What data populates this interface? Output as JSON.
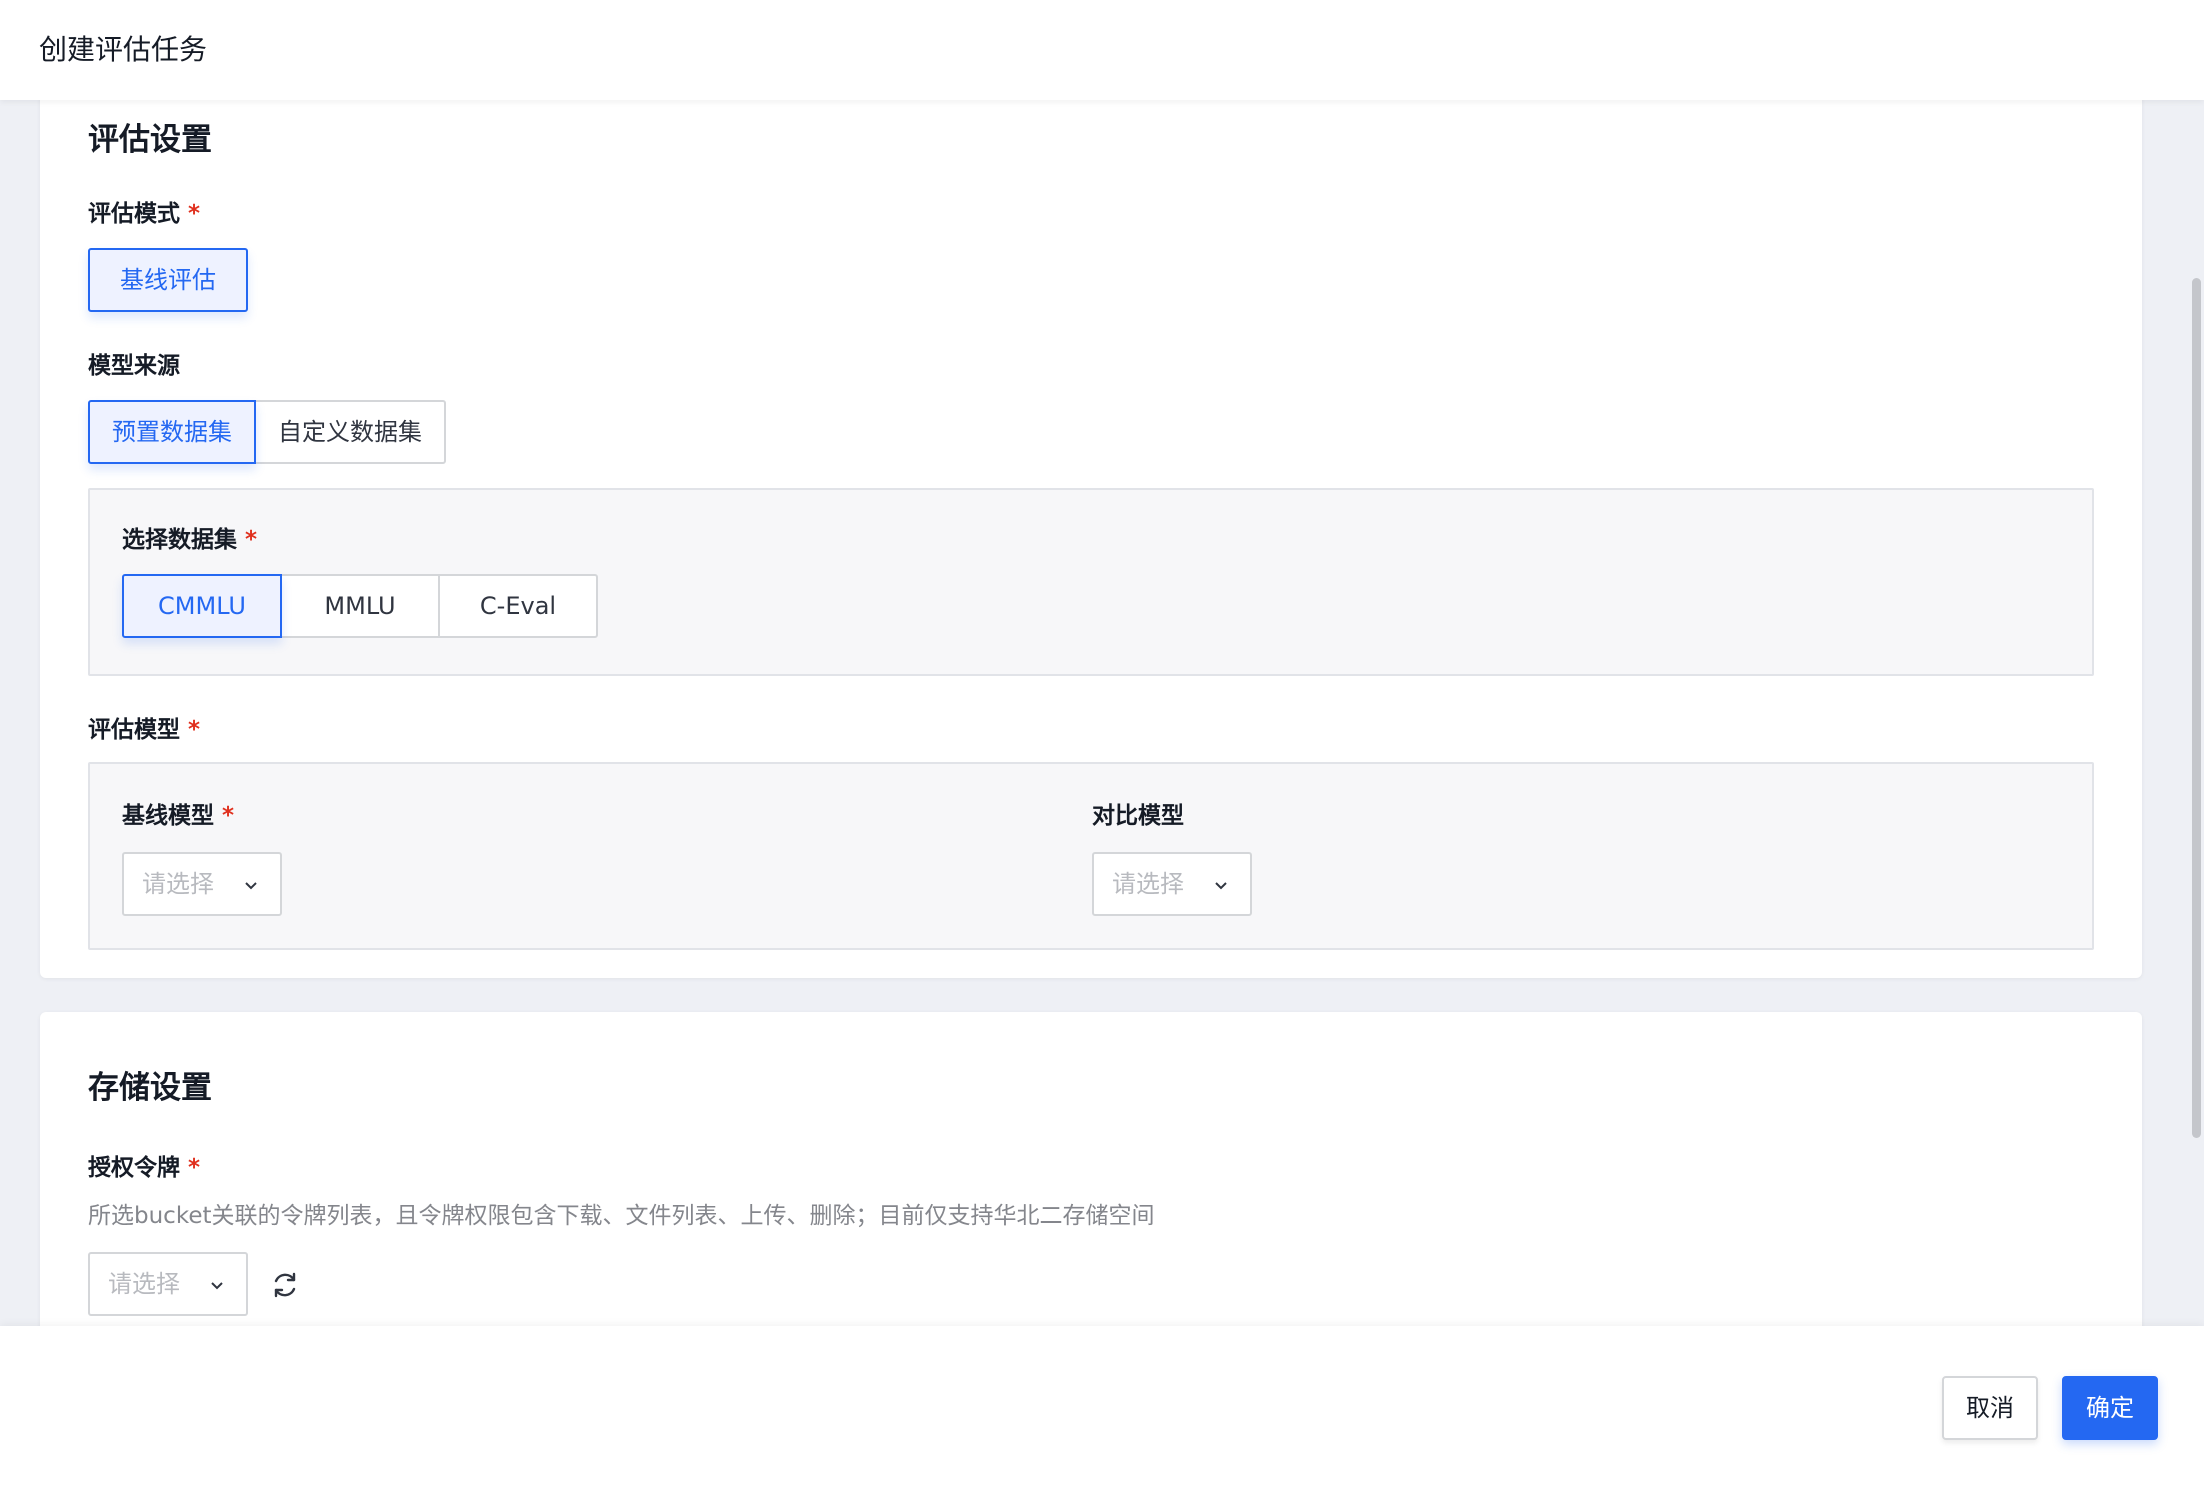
{
  "header": {
    "title": "创建评估任务"
  },
  "eval_settings": {
    "title": "评估设置",
    "mode": {
      "label": "评估模式",
      "required_mark": "*",
      "options": [
        "基线评估"
      ],
      "selected": "基线评估"
    },
    "model_source": {
      "label": "模型来源",
      "options": [
        "预置数据集",
        "自定义数据集"
      ],
      "selected": "预置数据集"
    },
    "dataset": {
      "label": "选择数据集",
      "required_mark": "*",
      "options": [
        "CMMLU",
        "MMLU",
        "C-Eval"
      ],
      "selected": "CMMLU"
    },
    "eval_model": {
      "label": "评估模型",
      "required_mark": "*",
      "baseline": {
        "label": "基线模型",
        "required_mark": "*",
        "placeholder": "请选择"
      },
      "compare": {
        "label": "对比模型",
        "placeholder": "请选择"
      }
    }
  },
  "storage_settings": {
    "title": "存储设置",
    "token": {
      "label": "授权令牌",
      "required_mark": "*",
      "description": "所选bucket关联的令牌列表，且令牌权限包含下载、文件列表、上传、删除；目前仅支持华北二存储空间",
      "placeholder": "请选择"
    }
  },
  "footer": {
    "cancel_label": "取消",
    "confirm_label": "确定"
  },
  "colors": {
    "accent": "#2468f2",
    "accent_bg": "#eef2ff",
    "required": "#e0301e",
    "border": "#d4d6d9",
    "panel_bg": "#f7f7f9",
    "page_bg": "#eef0f5"
  }
}
